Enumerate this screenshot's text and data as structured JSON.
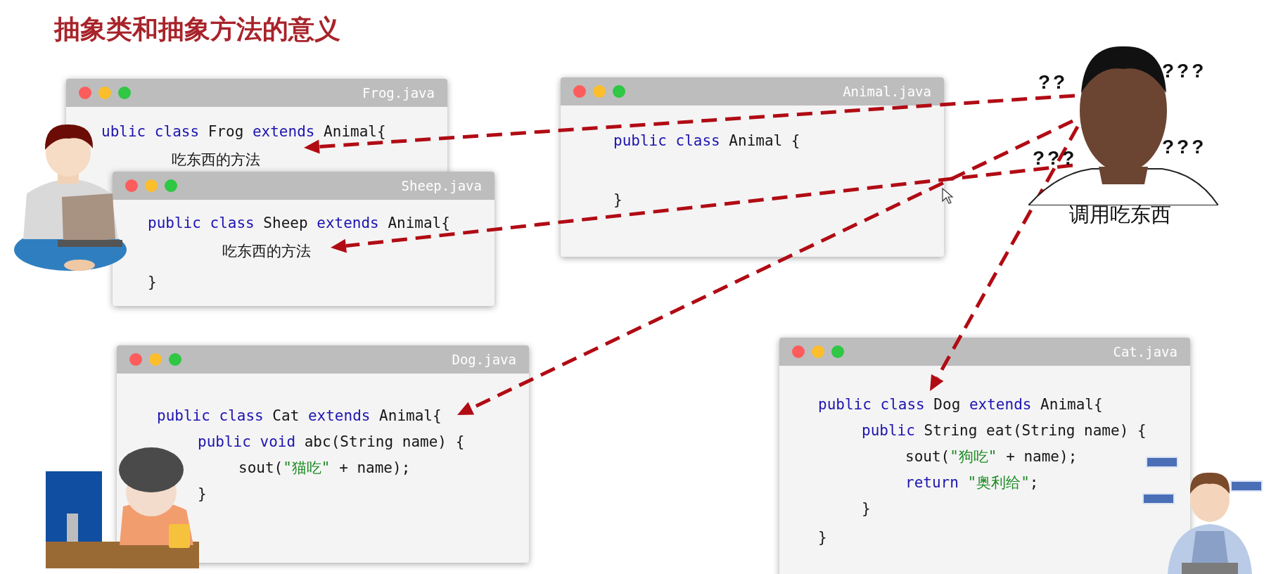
{
  "title": "抽象类和抽象方法的意义",
  "windows": [
    {
      "filename": "Frog.java",
      "lines": [
        {
          "tokens": [
            {
              "kind": "keyword",
              "text": "ublic class"
            },
            {
              "kind": "plain",
              "text": " Frog "
            },
            {
              "kind": "keyword",
              "text": "extends"
            },
            {
              "kind": "plain",
              "text": " Animal{"
            }
          ],
          "children": [
            {
              "tokens": [
                {
                  "kind": "plain",
                  "text": "吃东西的方法"
                }
              ]
            }
          ]
        }
      ]
    },
    {
      "filename": "Sheep.java",
      "lines": [
        {
          "tokens": [
            {
              "kind": "keyword",
              "text": "public class"
            },
            {
              "kind": "plain",
              "text": " Sheep "
            },
            {
              "kind": "keyword",
              "text": "extends"
            },
            {
              "kind": "plain",
              "text": " Animal{"
            }
          ],
          "children": [
            {
              "tokens": [
                {
                  "kind": "plain",
                  "text": "吃东西的方法"
                }
              ]
            }
          ]
        },
        {
          "tokens": [
            {
              "kind": "plain",
              "text": "}"
            }
          ]
        }
      ]
    },
    {
      "filename": "Animal.java",
      "lines": [
        {
          "tokens": [
            {
              "kind": "keyword",
              "text": "public class"
            },
            {
              "kind": "plain",
              "text": " Animal {"
            }
          ]
        },
        {
          "tokens": [
            {
              "kind": "plain",
              "text": "}"
            }
          ]
        }
      ]
    },
    {
      "filename": "Dog.java",
      "lines": [
        {
          "tokens": [
            {
              "kind": "keyword",
              "text": "public class"
            },
            {
              "kind": "plain",
              "text": " Cat "
            },
            {
              "kind": "keyword",
              "text": "extends"
            },
            {
              "kind": "plain",
              "text": " Animal{"
            }
          ],
          "children": [
            {
              "tokens": [
                {
                  "kind": "keyword",
                  "text": "public void"
                },
                {
                  "kind": "plain",
                  "text": " abc(String name) {"
                }
              ],
              "children": [
                {
                  "tokens": [
                    {
                      "kind": "plain",
                      "text": "sout("
                    },
                    {
                      "kind": "string",
                      "text": "\"猫吃\""
                    },
                    {
                      "kind": "plain",
                      "text": " + name);"
                    }
                  ]
                }
              ]
            },
            {
              "tokens": [
                {
                  "kind": "plain",
                  "text": "}"
                }
              ]
            }
          ]
        }
      ]
    },
    {
      "filename": "Cat.java",
      "lines": [
        {
          "tokens": [
            {
              "kind": "keyword",
              "text": "public class"
            },
            {
              "kind": "plain",
              "text": " Dog "
            },
            {
              "kind": "keyword",
              "text": "extends"
            },
            {
              "kind": "plain",
              "text": " Animal{"
            }
          ],
          "children": [
            {
              "tokens": [
                {
                  "kind": "keyword",
                  "text": "public"
                },
                {
                  "kind": "plain",
                  "text": " String eat(String name) {"
                }
              ],
              "children": [
                {
                  "tokens": [
                    {
                      "kind": "plain",
                      "text": "sout("
                    },
                    {
                      "kind": "string",
                      "text": "\"狗吃\""
                    },
                    {
                      "kind": "plain",
                      "text": " + name);"
                    }
                  ]
                },
                {
                  "tokens": [
                    {
                      "kind": "keyword",
                      "text": "return"
                    },
                    {
                      "kind": "string",
                      "text": " \"奥利给\""
                    },
                    {
                      "kind": "plain",
                      "text": ";"
                    }
                  ]
                }
              ]
            },
            {
              "tokens": [
                {
                  "kind": "plain",
                  "text": "}"
                }
              ]
            }
          ]
        },
        {
          "tokens": [
            {
              "kind": "plain",
              "text": "}"
            }
          ]
        }
      ]
    }
  ],
  "question_marks": [
    "??",
    "???",
    "???",
    "???"
  ],
  "caption": "调用吃东西"
}
